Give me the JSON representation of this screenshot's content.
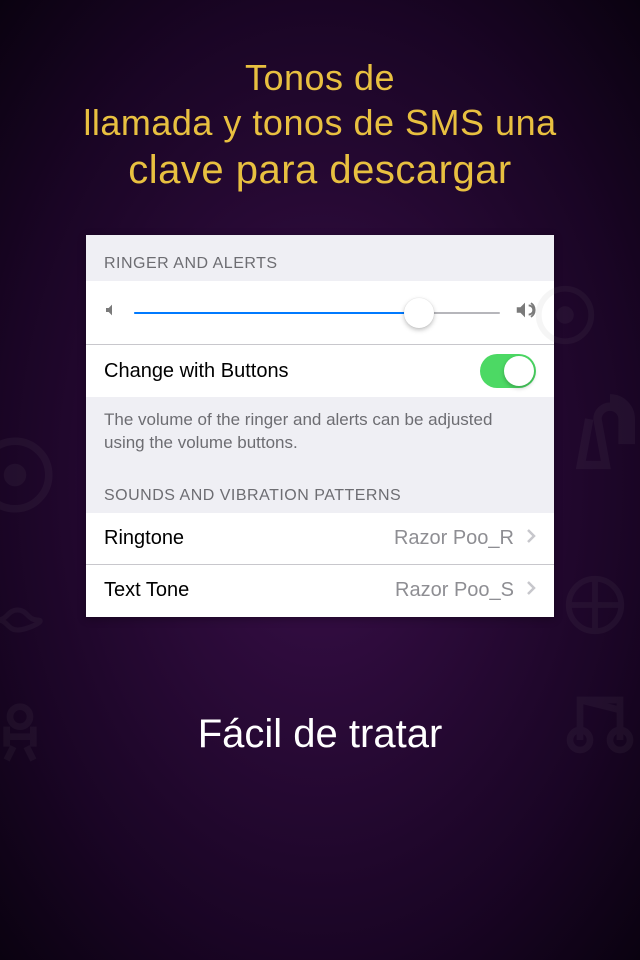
{
  "headline": {
    "line1": "Tonos de",
    "line2": "llamada y tonos de SMS una",
    "line3": "clave para descargar"
  },
  "panel": {
    "ringer": {
      "header": "RINGER AND ALERTS",
      "change_with_buttons": "Change with Buttons",
      "toggle_on": true,
      "footer_note": "The volume of the ringer and alerts can be adjusted using the volume buttons."
    },
    "sounds": {
      "header": "SOUNDS AND VIBRATION PATTERNS",
      "items": [
        {
          "label": "Ringtone",
          "value": "Razor Poo_R"
        },
        {
          "label": "Text Tone",
          "value": "Razor Poo_S"
        }
      ]
    }
  },
  "footer": "Fácil de tratar"
}
